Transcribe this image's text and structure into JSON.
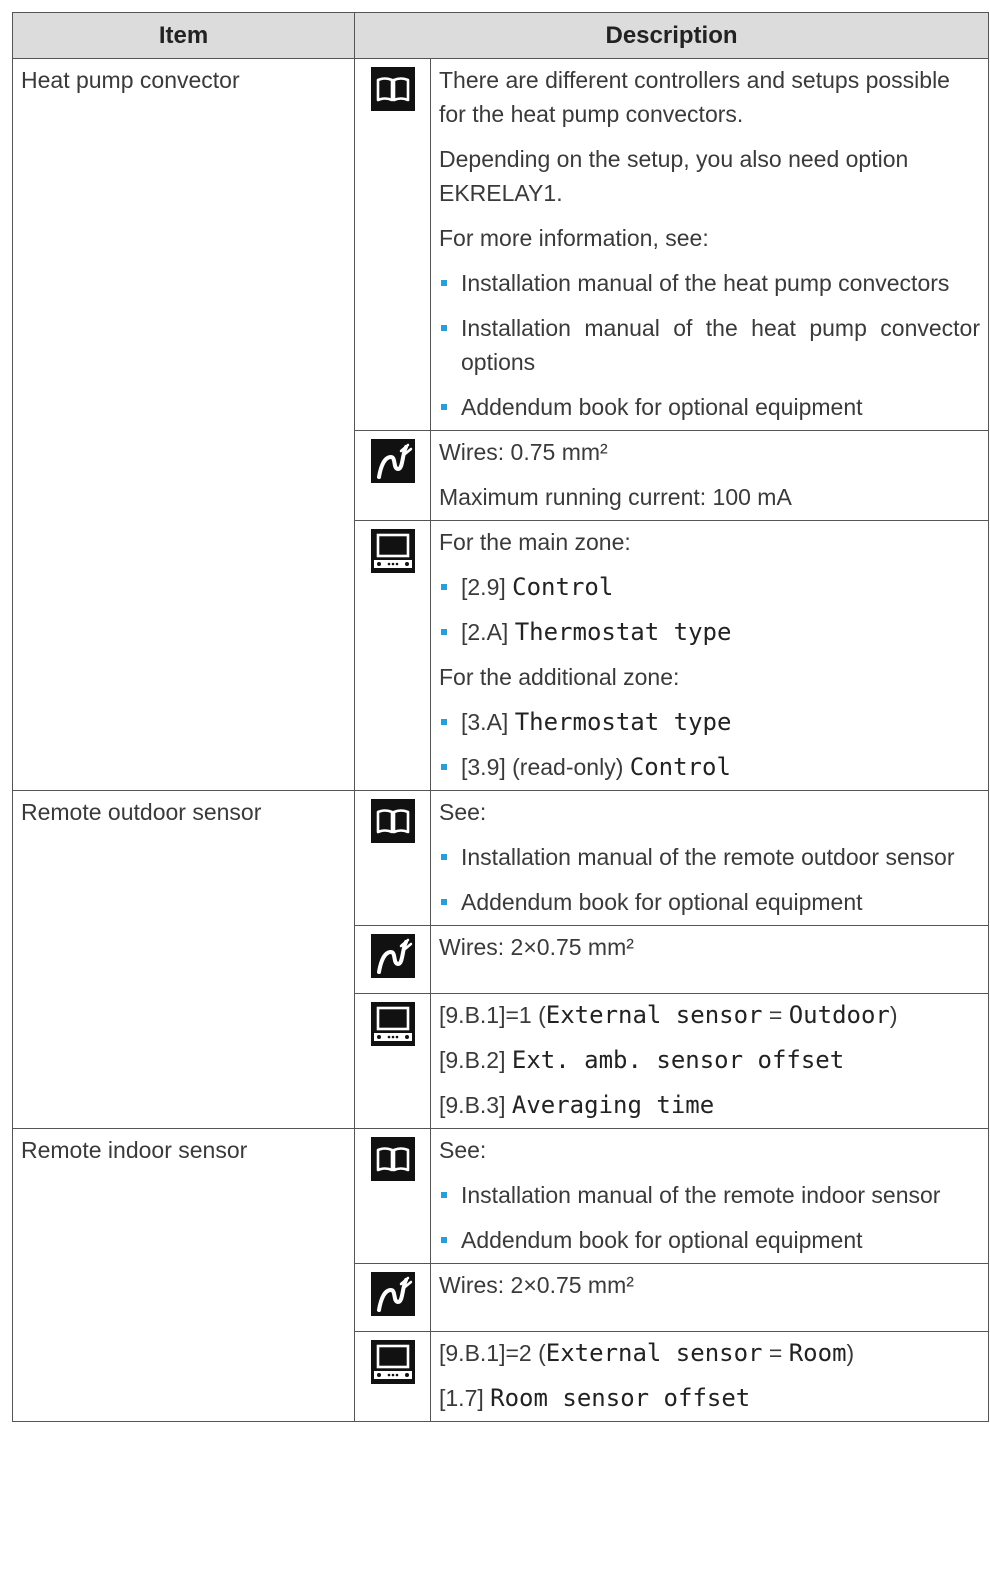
{
  "header": {
    "item": "Item",
    "description": "Description"
  },
  "icons": {
    "manual": "book-icon",
    "wires": "wire-icon",
    "controller": "controller-icon"
  },
  "accent": "#2a9fd6",
  "rows": [
    {
      "item": "Heat pump convector",
      "manual": {
        "p1": "There are different controllers and setups possible for the heat pump convectors.",
        "p2": "Depending on the setup, you also need option EKRELAY1.",
        "p3": "For more information, see:",
        "bullets": [
          "Installation manual of the heat pump convectors",
          "Installation manual of the heat pump convector options",
          "Addendum book for optional equipment"
        ]
      },
      "wires": {
        "line1": "Wires: 0.75 mm²",
        "line2": "Maximum running current: 100 mA"
      },
      "settings": {
        "main_zone": "For the main zone:",
        "b1_code": "[2.9]",
        "b1_name": "Control",
        "b2_code": "[2.A]",
        "b2_name": "Thermostat type",
        "additional_zone": "For the additional zone:",
        "b3_code": "[3.A]",
        "b3_name": "Thermostat type",
        "b4_code": "[3.9] (read-only)",
        "b4_name": "Control"
      }
    },
    {
      "item": "Remote outdoor sensor",
      "manual": {
        "p1": "See:",
        "bullets": [
          "Installation manual of the remote outdoor sensor",
          "Addendum book for optional equipment"
        ]
      },
      "wires": {
        "line1": "Wires: 2×0.75 mm²"
      },
      "settings": {
        "l1_code": "[9.B.1]=1 (",
        "l1_name": "External sensor",
        "l1_eq": " = ",
        "l1_val": "Outdoor",
        "l1_close": ")",
        "l2_code": "[9.B.2]",
        "l2_name": "Ext. amb. sensor offset",
        "l3_code": "[9.B.3]",
        "l3_name": "Averaging time"
      }
    },
    {
      "item": "Remote indoor sensor",
      "manual": {
        "p1": "See:",
        "bullets": [
          "Installation manual of the remote indoor sensor",
          "Addendum book for optional equipment"
        ]
      },
      "wires": {
        "line1": "Wires: 2×0.75 mm²"
      },
      "settings": {
        "l1_code": "[9.B.1]=2 (",
        "l1_name": "External sensor",
        "l1_eq": " = ",
        "l1_val": "Room",
        "l1_close": ")",
        "l2_code": "[1.7]",
        "l2_name": "Room sensor offset"
      }
    }
  ]
}
